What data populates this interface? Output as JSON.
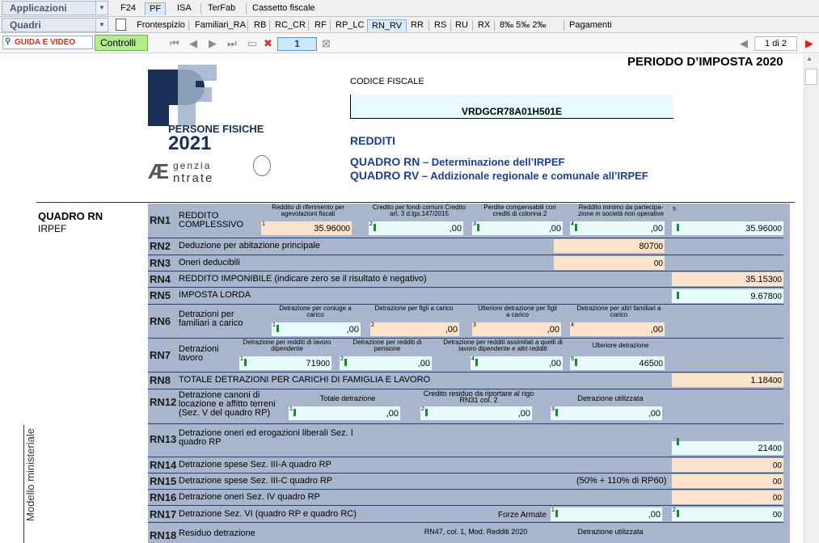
{
  "toolbar": {
    "applicazioni_label": "Applicazioni",
    "quadri_label": "Quadri",
    "top_tabs": [
      "F24",
      "PF",
      "ISA",
      "TerFab",
      "Cassetto fiscale"
    ],
    "quadri_tabs": [
      "Frontespizio",
      "Familiari_RA",
      "RB",
      "RC_CR",
      "RF",
      "RP_LC",
      "RN_RV",
      "RR",
      "RS",
      "RU",
      "RX",
      "8‰ 5‰ 2‰",
      "Pagamenti"
    ],
    "guida_label": "GUIDA E VIDEO",
    "controlli_label": "Controlli",
    "page_value": "1",
    "page_count": "1 di 2"
  },
  "header": {
    "periodo": "PERIODO D’IMPOSTA 2020",
    "codice_fiscale_label": "CODICE FISCALE",
    "codice_fiscale_value": "VRDGCR78A01H501E",
    "redditi": "REDDITI",
    "quadro_rn_code": "QUADRO RN",
    "quadro_rn_desc": " – Determinazione dell’IRPEF",
    "quadro_rv_code": "QUADRO RV",
    "quadro_rv_desc": " – Addizionale regionale e comunale all’IRPEF",
    "logo_letters": "PF",
    "logo_persone": "PERSONE FISICHE",
    "logo_year": "2021",
    "logo_agenzia": "genzia",
    "logo_entrate": "ntrate"
  },
  "side": {
    "quadro": "QUADRO RN",
    "irpef": "IRPEF",
    "modello": "Modello ministeriale"
  },
  "rows": {
    "rn1": {
      "code": "RN1",
      "label": "REDDITO\nCOMPLESSIVO",
      "cap1": "Reddito di riferimento per agevolazioni fiscali",
      "v1": "35.960",
      "cap2": "Credito per fondi comuni Credito art. 3 d.lgs.147/2015",
      "v2": "",
      "cap3": "Perdite compensabili con crediti di colonna 2",
      "v3": "",
      "cap4": "Reddito minimo da partecipa- zione in società non operative",
      "v4": "",
      "v5": "35.960"
    },
    "rn2": {
      "code": "RN2",
      "label": "Deduzione per abitazione principale",
      "v": "807"
    },
    "rn3": {
      "code": "RN3",
      "label": "Oneri deducibili",
      "v": ""
    },
    "rn4": {
      "code": "RN4",
      "label": "REDDITO IMPONIBILE (indicare zero se il risultato è negativo)",
      "v": "35.153"
    },
    "rn5": {
      "code": "RN5",
      "label": "IMPOSTA LORDA",
      "v": "9.678"
    },
    "rn6": {
      "code": "RN6",
      "label": "Detrazioni per familiari a carico",
      "cap1": "Detrazione per coniuge a carico",
      "cap2": "Detrazione per figli a carico",
      "cap3": "Ulteriore detrazione per figli a carico",
      "cap4": "Detrazione per altri familiari a carico"
    },
    "rn7": {
      "code": "RN7",
      "label": "Detrazioni lavoro",
      "cap1": "Detrazione per redditi di lavoro dipendente",
      "v1": "719",
      "cap2": "Detrazione per redditi di pensione",
      "cap3": "Detrazione per redditi assimilati a quelli di lavoro dipendente e altri redditi",
      "cap5": "Ulteriore detrazione",
      "v5": "465"
    },
    "rn8": {
      "code": "RN8",
      "label": "TOTALE DETRAZIONI PER CARICHI DI FAMIGLIA E LAVORO",
      "v": "1.184"
    },
    "rn12": {
      "code": "RN12",
      "label": "Detrazione canoni di locazione e affitto terreni (Sez. V del quadro RP)",
      "cap1": "Totale detrazione",
      "cap2": "Credito residuo da riportare al rigo RN31 col. 2",
      "cap3": "Detrazione utilizzata"
    },
    "rn13": {
      "code": "RN13",
      "label": "Detrazione oneri ed erogazioni liberali Sez. I quadro RP",
      "v": "214"
    },
    "rn14": {
      "code": "RN14",
      "label": "Detrazione spese  Sez. III-A quadro RP"
    },
    "rn15": {
      "code": "RN15",
      "label": "Detrazione spese  Sez. III-C quadro RP",
      "note": "(50% + 110% di RP60)"
    },
    "rn16": {
      "code": "RN16",
      "label": "Detrazione oneri Sez. IV quadro RP"
    },
    "rn17": {
      "code": "RN17",
      "label": "Detrazione Sez. VI (quadro RP e quadro RC)",
      "forze": "Forze Armate"
    },
    "rn18": {
      "code": "RN18",
      "label": "Residuo detrazione",
      "cap1": "RN47, col. 1, Mod. Redditi 2020",
      "cap2": "Detrazione utilizzata"
    }
  },
  "decimals": ",00",
  "zero_dec": "00"
}
